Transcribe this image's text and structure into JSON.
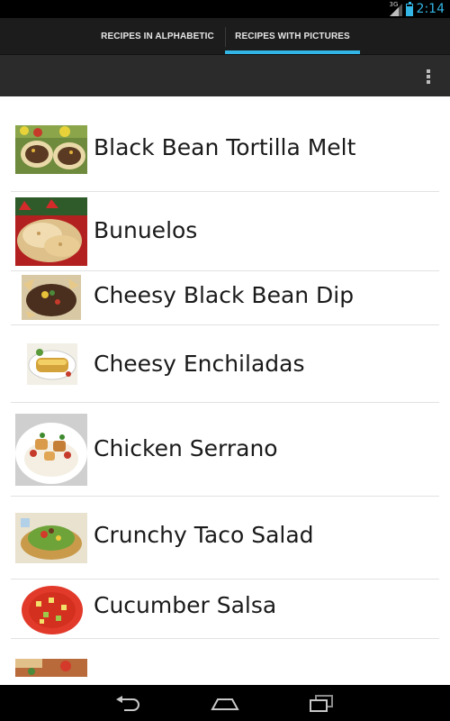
{
  "status_bar": {
    "network": "3G",
    "time": "2:14",
    "battery_level": 0.8,
    "colors": {
      "accent": "#33b5e5"
    }
  },
  "tabs": [
    {
      "label": "RECIPES IN ALPHABETIC",
      "selected": false
    },
    {
      "label": "RECIPES WITH PICTURES",
      "selected": true
    }
  ],
  "action_bar": {
    "overflow_icon": "overflow-menu-icon"
  },
  "recipes": [
    {
      "name": "Black Bean Tortilla Melt",
      "thumbnail": "tortilla-melt-photo"
    },
    {
      "name": "Bunuelos",
      "thumbnail": "bunuelos-photo"
    },
    {
      "name": "Cheesy Black Bean Dip",
      "thumbnail": "bean-dip-photo"
    },
    {
      "name": "Cheesy Enchiladas",
      "thumbnail": "enchiladas-photo"
    },
    {
      "name": "Chicken Serrano",
      "thumbnail": "chicken-serrano-photo"
    },
    {
      "name": "Crunchy Taco Salad",
      "thumbnail": "taco-salad-photo"
    },
    {
      "name": "Cucumber Salsa",
      "thumbnail": "cucumber-salsa-photo"
    },
    {
      "name": "",
      "thumbnail": "partial-recipe-photo"
    }
  ],
  "nav_bar": {
    "back_icon": "back-icon",
    "home_icon": "home-icon",
    "recents_icon": "recents-icon"
  }
}
